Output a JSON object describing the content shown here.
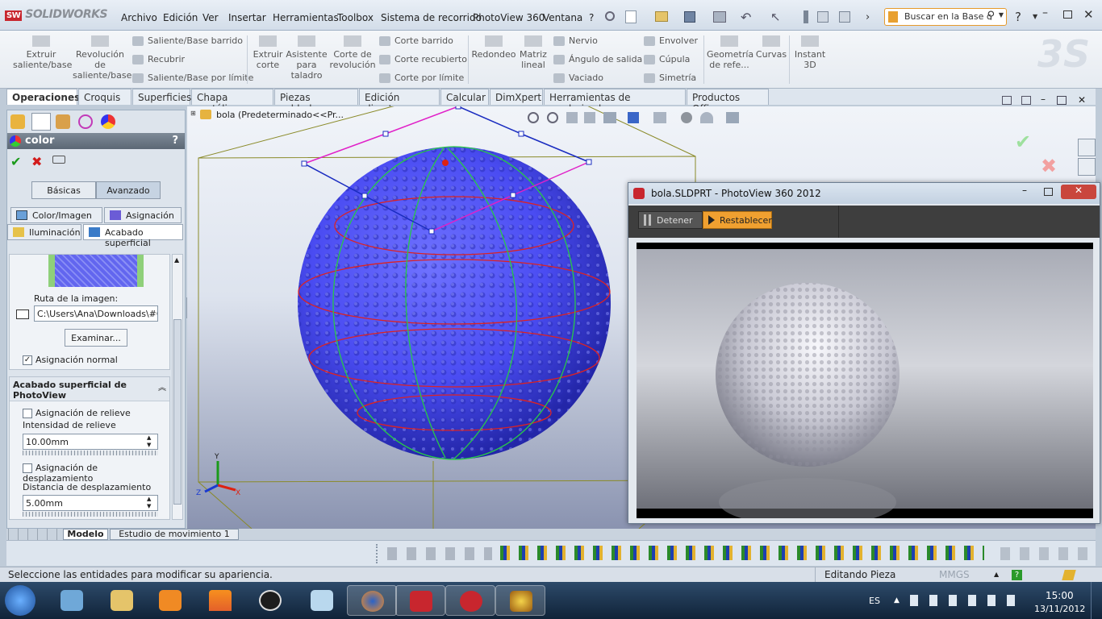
{
  "app": {
    "name": "SOLIDWORKS",
    "logo_badge": "SW"
  },
  "menu": [
    "Archivo",
    "Edición",
    "Ver",
    "Insertar",
    "Herramientas",
    "Toolbox",
    "Sistema de recorrido",
    "PhotoView 360",
    "Ventana",
    "?"
  ],
  "search": {
    "placeholder": "Buscar en la Base c"
  },
  "ribbon": {
    "big": [
      {
        "label": "Extruir saliente/base"
      },
      {
        "label": "Revolución de saliente/base"
      },
      {
        "label": "Extruir corte"
      },
      {
        "label": "Asistente para taladro"
      },
      {
        "label": "Corte de revolución"
      },
      {
        "label": "Redondeo"
      },
      {
        "label": "Matriz lineal"
      },
      {
        "label": "Geometría de refe..."
      },
      {
        "label": "Curvas"
      },
      {
        "label": "Instant 3D"
      }
    ],
    "small_col1": [
      "Saliente/Base barrido",
      "Recubrir",
      "Saliente/Base por límite"
    ],
    "small_col2": [
      "Corte barrido",
      "Corte recubierto",
      "Corte por límite"
    ],
    "small_col3": [
      "Nervio",
      "Ángulo de salida",
      "Vaciado"
    ],
    "small_col4": [
      "Envolver",
      "Cúpula",
      "Simetría"
    ]
  },
  "tabs": [
    "Operaciones",
    "Croquis",
    "Superficies",
    "Chapa metálica",
    "Piezas soldadas",
    "Edición directa",
    "Calcular",
    "DimXpert",
    "Herramientas de renderizado",
    "Productos Office"
  ],
  "panel": {
    "title": "color",
    "help": "?",
    "mode_buttons": [
      "Básicas",
      "Avanzado"
    ],
    "subtabs_row1": [
      "Color/Imagen",
      "Asignación"
    ],
    "subtabs_row2": [
      "Iluminación",
      "Acabado superficial"
    ],
    "image_path_label": "Ruta de la imagen:",
    "image_path_value": "C:\\Users\\Ana\\Downloads\\#CA",
    "browse": "Examinar...",
    "normal_mapping": "Asignación normal",
    "section_title": "Acabado superficial de PhotoView",
    "bump_mapping": "Asignación de relieve",
    "bump_intensity_label": "Intensidad de relieve",
    "bump_intensity_value": "10.00mm",
    "displacement_mapping": "Asignación de desplazamiento",
    "displacement_distance_label": "Distancia de desplazamiento",
    "displacement_distance_value": "5.00mm"
  },
  "viewport": {
    "tree_label": "bola  (Predeterminado<<Pr..."
  },
  "photoview": {
    "title": "bola.SLDPRT - PhotoView 360 2012",
    "stop": "Detener",
    "reset": "Restablecer"
  },
  "bottom_tabs": [
    "Modelo",
    "Estudio de movimiento 1"
  ],
  "status": {
    "message": "Seleccione las entidades para modificar su apariencia.",
    "mode": "Editando Pieza",
    "units": "MMGS"
  },
  "taskbar": {
    "lang": "ES",
    "time": "15:00",
    "date": "13/11/2012"
  },
  "colors": {
    "sphere": "#4b4cf0",
    "accent_orange": "#f0a030",
    "taskbar": "#1a3350"
  }
}
